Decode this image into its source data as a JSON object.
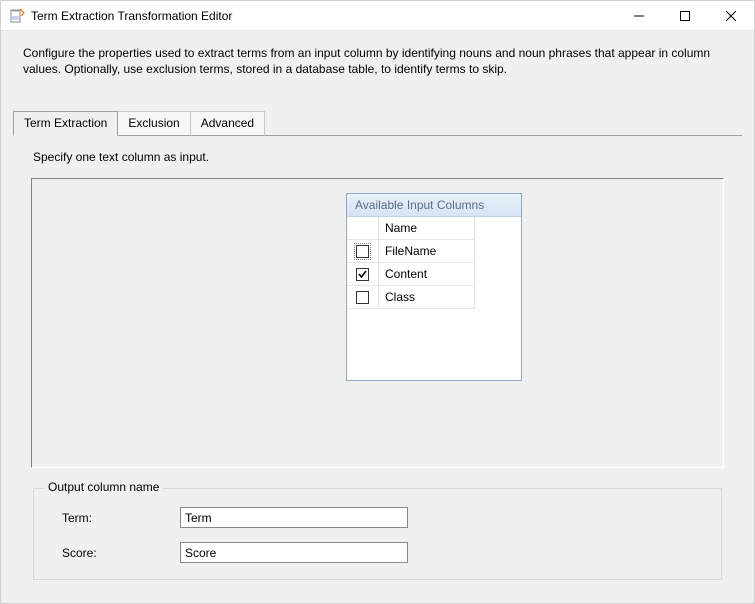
{
  "window": {
    "title": "Term Extraction Transformation Editor"
  },
  "description": "Configure the properties used to extract terms from an input column by identifying nouns and noun phrases that appear in column values. Optionally, use exclusion terms, stored in a database table, to identify terms to skip.",
  "tabs": {
    "items": [
      {
        "label": "Term Extraction",
        "active": true
      },
      {
        "label": "Exclusion",
        "active": false
      },
      {
        "label": "Advanced",
        "active": false
      }
    ]
  },
  "panel": {
    "instruction": "Specify one text column as input.",
    "columns_panel": {
      "title": "Available Input Columns",
      "header": {
        "check": "",
        "name": "Name"
      },
      "rows": [
        {
          "name": "FileName",
          "checked": false
        },
        {
          "name": "Content",
          "checked": true
        },
        {
          "name": "Class",
          "checked": false
        }
      ]
    }
  },
  "output_group": {
    "legend": "Output column name",
    "term_label": "Term:",
    "term_value": "Term",
    "score_label": "Score:",
    "score_value": "Score"
  }
}
